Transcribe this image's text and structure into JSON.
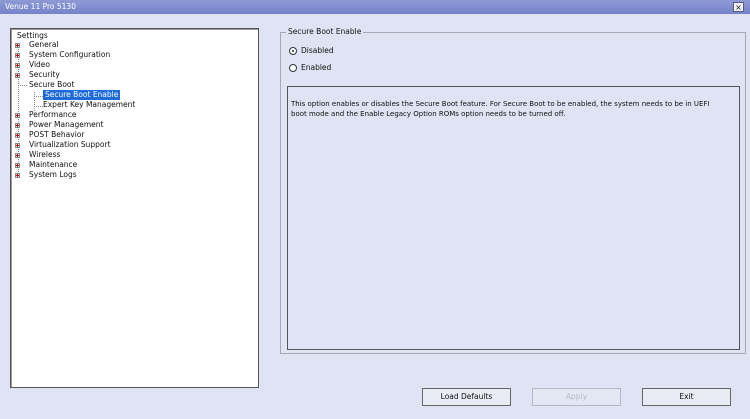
{
  "window": {
    "title": "Venue 11 Pro 5130",
    "close_icon": "close-icon",
    "close_glyph": "×"
  },
  "tree": {
    "root": "Settings",
    "items": [
      {
        "label": "General"
      },
      {
        "label": "System Configuration"
      },
      {
        "label": "Video"
      },
      {
        "label": "Security"
      },
      {
        "label": "Secure Boot"
      },
      {
        "label": "Secure Boot Enable",
        "selected": true
      },
      {
        "label": "Expert Key Management"
      },
      {
        "label": "Performance"
      },
      {
        "label": "Power Management"
      },
      {
        "label": "POST Behavior"
      },
      {
        "label": "Virtualization Support"
      },
      {
        "label": "Wireless"
      },
      {
        "label": "Maintenance"
      },
      {
        "label": "System Logs"
      }
    ]
  },
  "main": {
    "group_title": "Secure Boot Enable",
    "options": [
      {
        "label": "Disabled",
        "checked": true
      },
      {
        "label": "Enabled",
        "checked": false
      }
    ],
    "description": "This option enables or disables the Secure Boot feature. For Secure Boot to be enabled, the system needs to be in UEFI boot mode and the Enable Legacy Option ROMs option needs to be turned off."
  },
  "buttons": {
    "load_defaults": "Load Defaults",
    "apply": "Apply",
    "exit": "Exit"
  },
  "colors": {
    "selection": "#1e6cdc",
    "titlebar": "#7f8dcf",
    "background": "#dfe3f3"
  }
}
